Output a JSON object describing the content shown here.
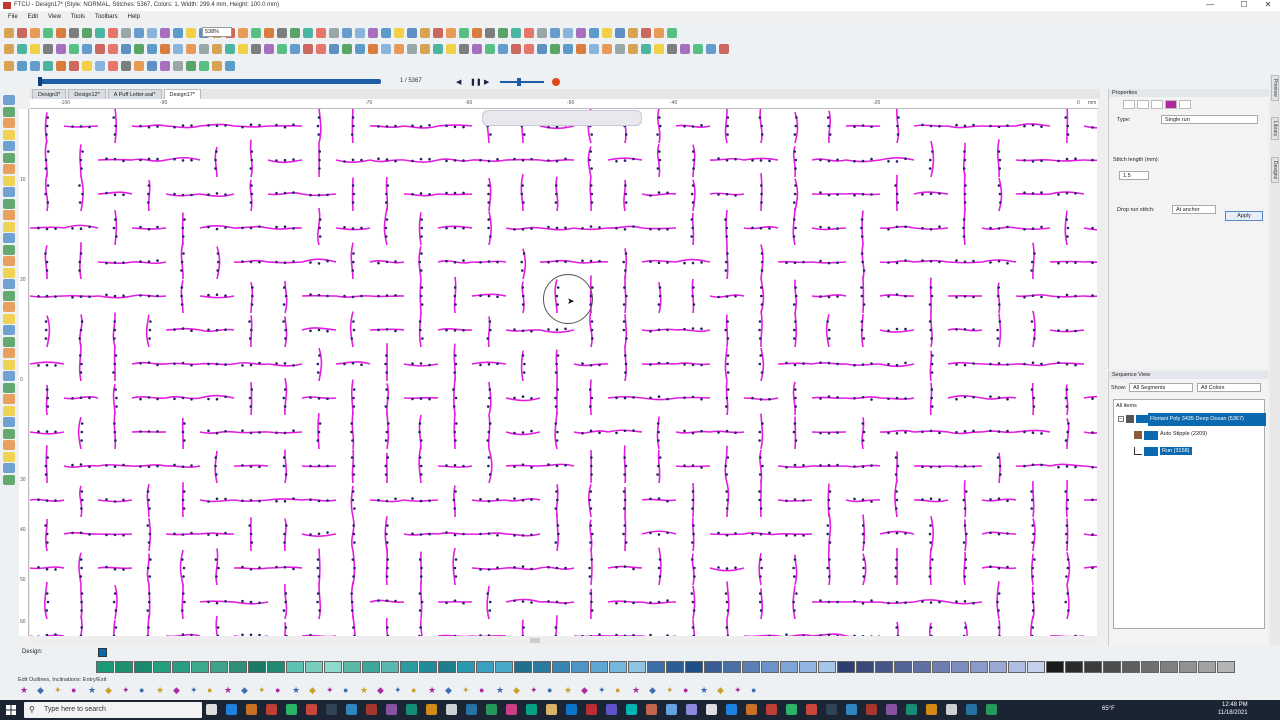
{
  "window": {
    "title": "FTCU - Design17* (Style: NORMAL, Stitches: 5367, Colors: 1, Width: 299.4 mm, Height: 100.0 mm)",
    "minimize": "—",
    "maximize": "☐",
    "close": "✕"
  },
  "menu": [
    "File",
    "Edit",
    "View",
    "Tools",
    "Toolbars",
    "Help"
  ],
  "toolbar": {
    "zoom_value": "538%"
  },
  "progress": {
    "label": "1 / 5367",
    "fraction": 0.0002
  },
  "tabs": [
    {
      "label": "Design3*",
      "active": false
    },
    {
      "label": "Design12*",
      "active": false
    },
    {
      "label": "A Puff Letter.wal*",
      "active": false
    },
    {
      "label": "Design17*",
      "active": true
    }
  ],
  "ruler": {
    "h_ticks": [
      "-100",
      "-90",
      "-70",
      "-60",
      "-50",
      "-40",
      "-20",
      "0"
    ],
    "h_unit": "mm",
    "v_ticks": [
      "10",
      "20",
      "0",
      "30",
      "40",
      "50",
      "60"
    ]
  },
  "properties": {
    "header": "Properties",
    "type_label": "Type:",
    "type_value": "Single run",
    "stitch_length_label": "Stitch length (mm):",
    "stitch_length_value": "1.5",
    "drop_run_label": "Drop run stitch:",
    "drop_run_value": "At anchor",
    "apply_label": "Apply"
  },
  "side_tabs": [
    "Preview",
    "Library",
    "Designs"
  ],
  "sequence": {
    "header": "Sequence View",
    "show_label": "Show:",
    "filter_segments": "All Segments",
    "filter_colors": "All Colors",
    "root": "All items",
    "thread": "Floriani Poly 3435 Deep Ocean (5367)",
    "items": [
      "Auto Stipple (2209)",
      "Run (3158)"
    ]
  },
  "design_bar": {
    "label": "Design:",
    "swatches": [
      "#1b9a7a",
      "#1e8f6f",
      "#198a6d",
      "#22a07f",
      "#2a9e84",
      "#3aaa8f",
      "#3da38a",
      "#2f8f7a",
      "#1a7a66",
      "#208a74",
      "#5fc1b1",
      "#79cdbf",
      "#8ed8cc",
      "#5bb8a7",
      "#3fa79a",
      "#58b8b0",
      "#2a9ca0",
      "#1f8c99",
      "#1d7f8e",
      "#2a98b0",
      "#3a9fc0",
      "#4aa9c9",
      "#1f6f8e",
      "#2a7aa0",
      "#3884b3",
      "#4b96c7",
      "#5ea7d4",
      "#76b6dc",
      "#8ec4e2",
      "#3b6fa6",
      "#2b5e96",
      "#1e4f86",
      "#395d92",
      "#4a6fa4",
      "#5b80b6",
      "#6c92c7",
      "#7fa4d6",
      "#92b5e2",
      "#a6c5ea",
      "#2c3f6e",
      "#38497a",
      "#455687",
      "#536395",
      "#6070a3",
      "#6e7eb1",
      "#7c8cbf",
      "#8a9acc",
      "#9ba8d6",
      "#b0bde2",
      "#c5d0ee",
      "#1a1a1a",
      "#2b2b2b",
      "#3c3c3c",
      "#4d4d4d",
      "#5e5e5e",
      "#6f6f6f",
      "#808080",
      "#919191",
      "#a2a2a2",
      "#b3b3b3"
    ]
  },
  "status": {
    "text": "Edit Outlines, Inclinations: Entry/Exit"
  },
  "taskbar": {
    "search_placeholder": "Type here to search",
    "weather": "65°F",
    "time": "12:48 PM",
    "date": "11/18/2021"
  },
  "colors": {
    "stitch": "#e21ce0",
    "node": "#222266",
    "accent": "#1c5fa8",
    "selection": "#0b6aaf"
  }
}
